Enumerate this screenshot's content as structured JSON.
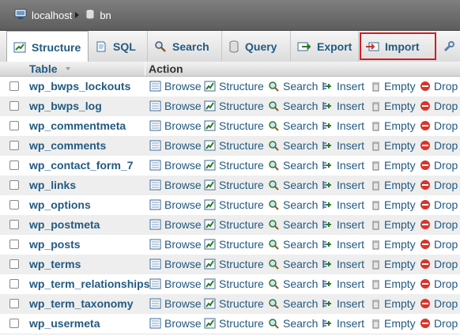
{
  "breadcrumb": {
    "server": "localhost",
    "database": "bn"
  },
  "tabs": [
    {
      "id": "structure",
      "label": "Structure",
      "icon": "structure-icon",
      "active": true
    },
    {
      "id": "sql",
      "label": "SQL",
      "icon": "sql-icon",
      "active": false
    },
    {
      "id": "search",
      "label": "Search",
      "icon": "search-icon",
      "active": false
    },
    {
      "id": "query",
      "label": "Query",
      "icon": "query-icon",
      "active": false
    },
    {
      "id": "export",
      "label": "Export",
      "icon": "export-icon",
      "active": false
    },
    {
      "id": "import",
      "label": "Import",
      "icon": "import-icon",
      "active": false,
      "highlighted": true
    },
    {
      "id": "operations",
      "label": "",
      "icon": "wrench-icon",
      "active": false
    }
  ],
  "colors": {
    "link": "#235a81",
    "highlight": "#d11d24",
    "drop": "#d9342b"
  },
  "table": {
    "header_table": "Table",
    "header_action": "Action",
    "actions": {
      "browse": "Browse",
      "structure": "Structure",
      "search": "Search",
      "insert": "Insert",
      "empty": "Empty",
      "drop": "Drop"
    },
    "rows": [
      "wp_bwps_lockouts",
      "wp_bwps_log",
      "wp_commentmeta",
      "wp_comments",
      "wp_contact_form_7",
      "wp_links",
      "wp_options",
      "wp_postmeta",
      "wp_posts",
      "wp_terms",
      "wp_term_relationships",
      "wp_term_taxonomy",
      "wp_usermeta"
    ]
  }
}
